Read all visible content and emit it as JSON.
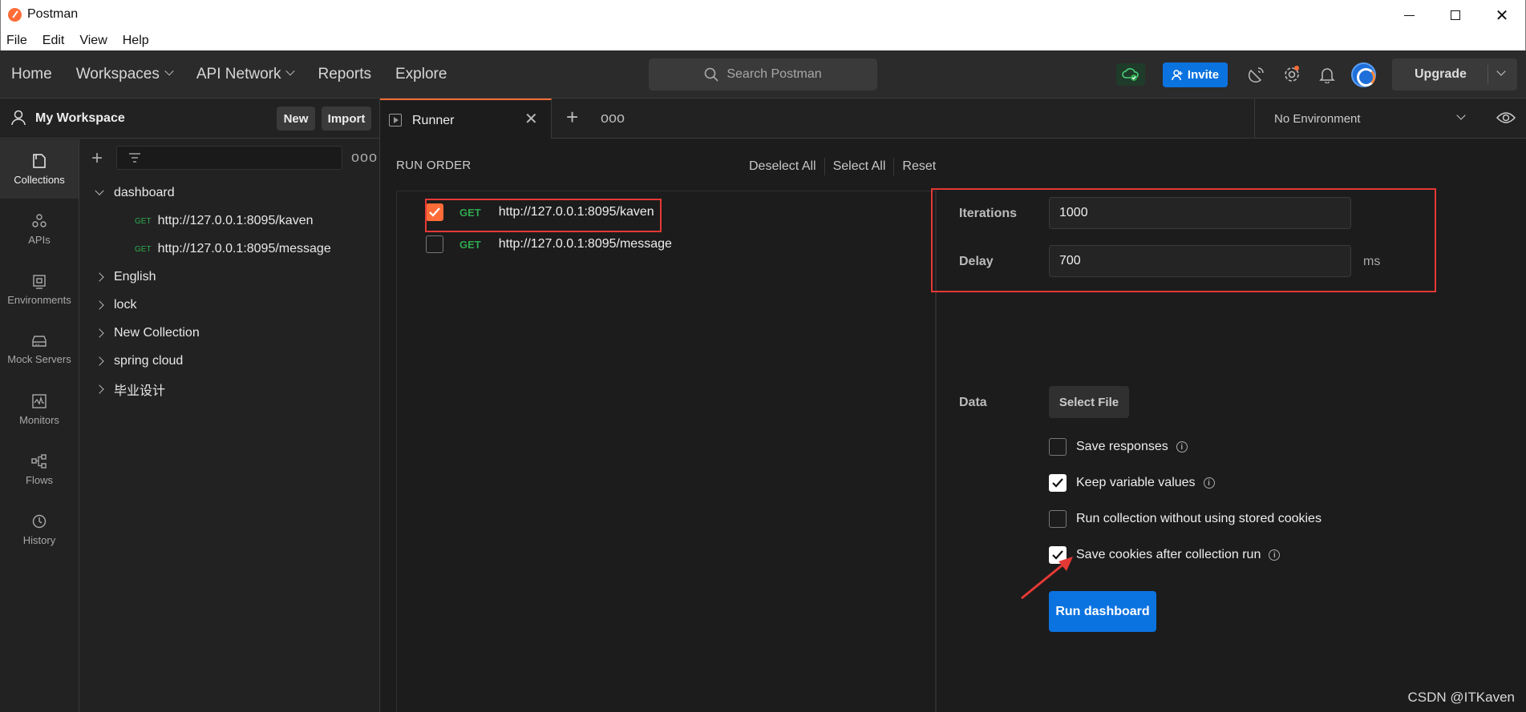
{
  "window": {
    "title": "Postman"
  },
  "menu": [
    "File",
    "Edit",
    "View",
    "Help"
  ],
  "header": {
    "nav": [
      {
        "label": "Home",
        "dropdown": false
      },
      {
        "label": "Workspaces",
        "dropdown": true
      },
      {
        "label": "API Network",
        "dropdown": true
      },
      {
        "label": "Reports",
        "dropdown": false
      },
      {
        "label": "Explore",
        "dropdown": false
      }
    ],
    "search_placeholder": "Search Postman",
    "invite_label": "Invite",
    "upgrade_label": "Upgrade"
  },
  "sidebar": {
    "workspace_name": "My Workspace",
    "new_label": "New",
    "import_label": "Import",
    "rail": [
      "Collections",
      "APIs",
      "Environments",
      "Mock Servers",
      "Monitors",
      "Flows",
      "History"
    ],
    "collections": [
      {
        "name": "dashboard",
        "expanded": true,
        "requests": [
          {
            "method": "GET",
            "url": "http://127.0.0.1:8095/kaven"
          },
          {
            "method": "GET",
            "url": "http://127.0.0.1:8095/message"
          }
        ]
      },
      {
        "name": "English",
        "expanded": false
      },
      {
        "name": "lock",
        "expanded": false
      },
      {
        "name": "New Collection",
        "expanded": false
      },
      {
        "name": "spring cloud",
        "expanded": false
      },
      {
        "name": "毕业设计",
        "expanded": false
      }
    ]
  },
  "tabs": {
    "active_label": "Runner",
    "environment": "No Environment"
  },
  "runner": {
    "run_order_title": "RUN ORDER",
    "links": [
      "Deselect All",
      "Select All",
      "Reset"
    ],
    "requests": [
      {
        "method": "GET",
        "url": "http://127.0.0.1:8095/kaven",
        "checked": true
      },
      {
        "method": "GET",
        "url": "http://127.0.0.1:8095/message",
        "checked": false
      }
    ],
    "iterations_label": "Iterations",
    "iterations_value": "1000",
    "delay_label": "Delay",
    "delay_value": "700",
    "delay_unit": "ms",
    "data_label": "Data",
    "select_file_label": "Select File",
    "options": [
      {
        "label": "Save responses",
        "checked": false,
        "info": true
      },
      {
        "label": "Keep variable values",
        "checked": true,
        "info": true
      },
      {
        "label": "Run collection without using stored cookies",
        "checked": false,
        "info": false
      },
      {
        "label": "Save cookies after collection run",
        "checked": true,
        "info": true
      }
    ],
    "run_button_label": "Run dashboard"
  },
  "watermark": "CSDN @ITKaven",
  "colors": {
    "accent": "#ff6c37",
    "primary_button": "#0b73e0",
    "get_method": "#2fa84f",
    "highlight": "#e53935"
  }
}
